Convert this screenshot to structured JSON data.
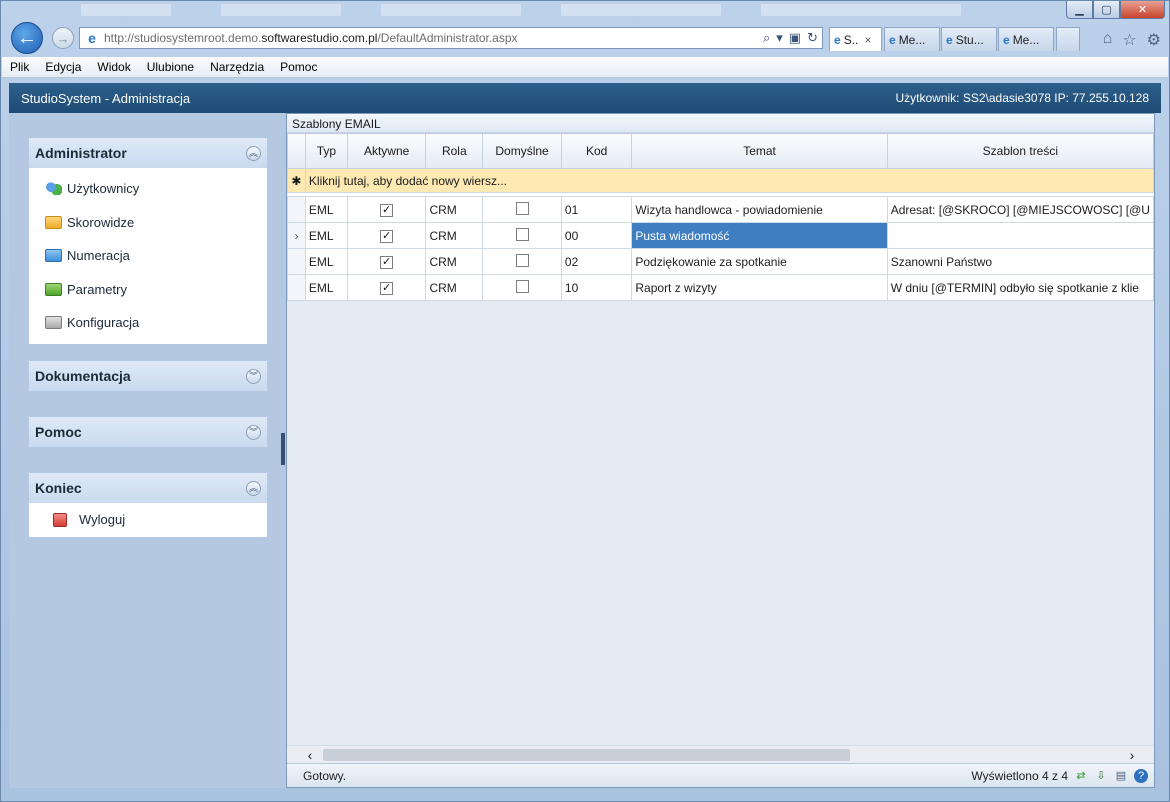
{
  "browser": {
    "url_prefix": "http://studiosystemroot.demo.",
    "url_domain": "softwarestudio.com.pl",
    "url_suffix": "/DefaultAdministrator.aspx",
    "tabs": [
      {
        "label": "S..",
        "close": "×",
        "active": true
      },
      {
        "label": "Me...",
        "active": false
      },
      {
        "label": "Stu...",
        "active": false
      },
      {
        "label": "Me...",
        "active": false
      }
    ]
  },
  "menubar": {
    "items": [
      "Plik",
      "Edycja",
      "Widok",
      "Ulubione",
      "Narzędzia",
      "Pomoc"
    ]
  },
  "header": {
    "title": "StudioSystem - Administracja",
    "user_info": "Użytkownik: SS2\\adasie3078 IP: 77.255.10.128"
  },
  "sidebar": {
    "sections": [
      {
        "title": "Administrator",
        "expanded": true,
        "items": [
          {
            "label": "Użytkownicy",
            "icon": "users-icon"
          },
          {
            "label": "Skorowidze",
            "icon": "folder-yellow-icon"
          },
          {
            "label": "Numeracja",
            "icon": "folder-blue-icon"
          },
          {
            "label": "Parametry",
            "icon": "folder-green-icon"
          },
          {
            "label": "Konfiguracja",
            "icon": "folder-gray-icon"
          }
        ]
      },
      {
        "title": "Dokumentacja",
        "expanded": false,
        "items": []
      },
      {
        "title": "Pomoc",
        "expanded": false,
        "items": []
      },
      {
        "title": "Koniec",
        "expanded": true,
        "items": [
          {
            "label": "Wyloguj",
            "icon": "logout-icon"
          }
        ]
      }
    ]
  },
  "grid": {
    "title": "Szablony EMAIL",
    "columns": [
      "Typ",
      "Aktywne",
      "Rola",
      "Domyślne",
      "Kod",
      "Temat",
      "Szablon treści"
    ],
    "new_row_text": "Kliknij tutaj, aby dodać nowy wiersz...",
    "rows": [
      {
        "typ": "EML",
        "aktywne": true,
        "rola": "CRM",
        "domyslne": false,
        "kod": "01",
        "temat": "Wizyta handlowca - powiadomienie",
        "szablon": "Adresat: [@SKROCO] [@MIEJSCOWOSC] [@U"
      },
      {
        "typ": "EML",
        "aktywne": true,
        "rola": "CRM",
        "domyslne": false,
        "kod": "00",
        "temat": "Pusta wiadomość",
        "szablon": "",
        "selected": true
      },
      {
        "typ": "EML",
        "aktywne": true,
        "rola": "CRM",
        "domyslne": false,
        "kod": "02",
        "temat": "Podziękowanie za spotkanie",
        "szablon": "Szanowni Państwo"
      },
      {
        "typ": "EML",
        "aktywne": true,
        "rola": "CRM",
        "domyslne": false,
        "kod": "10",
        "temat": "Raport z wizyty",
        "szablon": "W dniu [@TERMIN] odbyło się spotkanie z klie"
      }
    ]
  },
  "status": {
    "left": "Gotowy.",
    "right": "Wyświetlono 4 z 4"
  },
  "colors": {
    "header_bg": "#2d5f8c",
    "selected_cell": "#3f7fc1",
    "new_row_bg": "#fde9b1",
    "sidebar_bg": "#b4c8e2"
  }
}
